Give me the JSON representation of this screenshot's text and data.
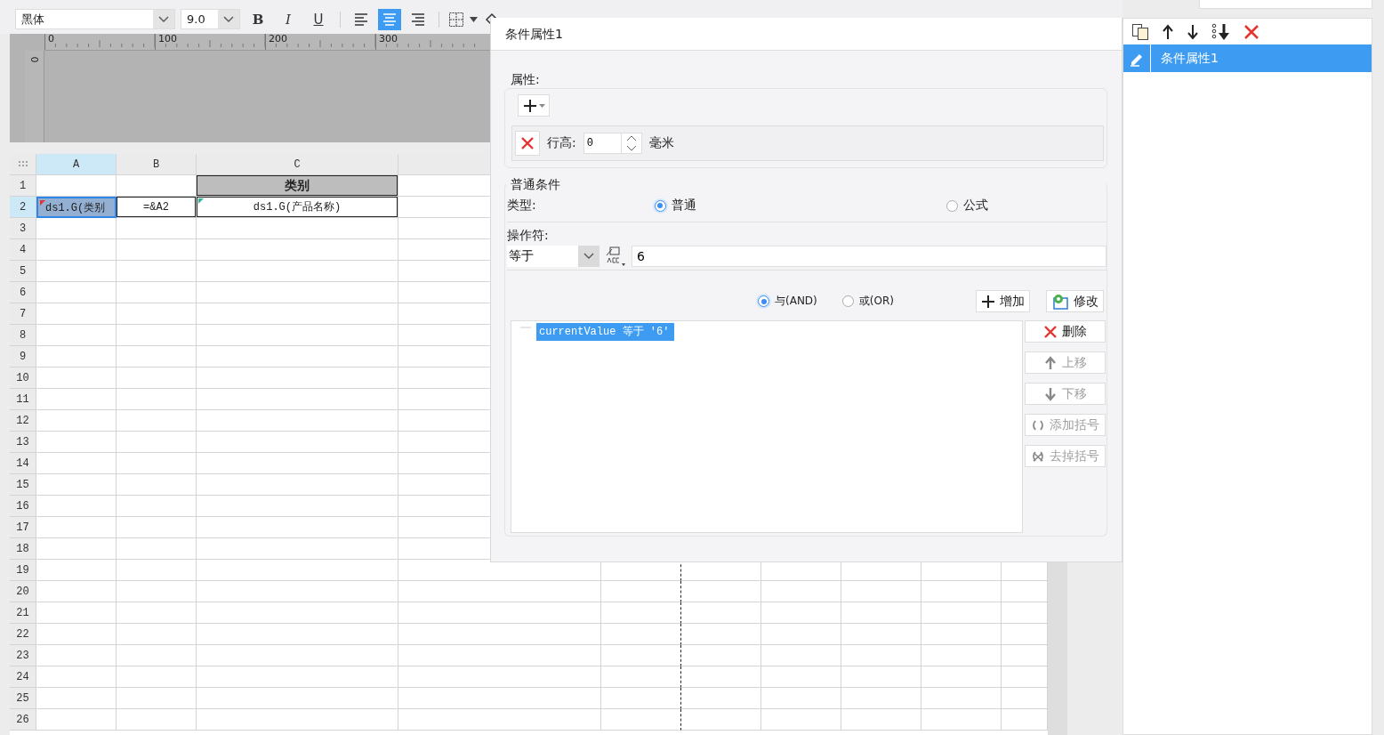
{
  "toolbar": {
    "font": "黑体",
    "size": "9.0",
    "format_buttons": [
      {
        "kind": "bold",
        "label": "B"
      },
      {
        "kind": "italic",
        "label": "I"
      },
      {
        "kind": "underline",
        "label": "U"
      }
    ],
    "align_buttons": [
      {
        "kind": "left",
        "selected": false
      },
      {
        "kind": "center",
        "selected": true
      },
      {
        "kind": "right",
        "selected": false
      }
    ]
  },
  "ruler": {
    "ticks": [
      "0",
      "100",
      "200",
      "300"
    ],
    "vertical_tick": "0"
  },
  "sheet": {
    "columns": [
      {
        "label": "A",
        "selected": true
      },
      {
        "label": "B",
        "selected": false
      },
      {
        "label": "C",
        "selected": false
      }
    ],
    "rows": [
      {
        "label": "1",
        "selected": false,
        "cells": [
          {
            "kind": "blank"
          },
          {
            "kind": "blank"
          },
          {
            "kind": "header",
            "text": "类别"
          }
        ]
      },
      {
        "label": "2",
        "selected": true,
        "cells": [
          {
            "kind": "selected",
            "text": "ds1.G(类别",
            "color": "#e8322f"
          },
          {
            "kind": "plain",
            "text": "=&A2"
          },
          {
            "kind": "plain",
            "text": "ds1.G(产品名称)",
            "color": "#2bb59a"
          }
        ]
      },
      {
        "label": "3",
        "selected": false
      },
      {
        "label": "4",
        "selected": false
      },
      {
        "label": "5",
        "selected": false
      },
      {
        "label": "6",
        "selected": false
      },
      {
        "label": "7",
        "selected": false
      },
      {
        "label": "8",
        "selected": false
      },
      {
        "label": "9",
        "selected": false
      },
      {
        "label": "10",
        "selected": false
      },
      {
        "label": "11",
        "selected": false
      },
      {
        "label": "12",
        "selected": false
      },
      {
        "label": "13",
        "selected": false
      },
      {
        "label": "14",
        "selected": false
      },
      {
        "label": "15",
        "selected": false
      },
      {
        "label": "16",
        "selected": false
      },
      {
        "label": "17",
        "selected": false
      },
      {
        "label": "18",
        "selected": false
      },
      {
        "label": "19",
        "selected": false
      },
      {
        "label": "20",
        "selected": false
      },
      {
        "label": "21",
        "selected": false
      },
      {
        "label": "22",
        "selected": false
      },
      {
        "label": "23",
        "selected": false
      },
      {
        "label": "24",
        "selected": false
      },
      {
        "label": "25",
        "selected": false
      },
      {
        "label": "26",
        "selected": false
      }
    ]
  },
  "dialog": {
    "title": "条件属性1",
    "properties_label": "属性:",
    "property": {
      "label": "行高:",
      "value": "0",
      "unit": "毫米"
    },
    "condition_group": "普通条件",
    "type_label": "类型:",
    "types": [
      {
        "label": "普通",
        "selected": true
      },
      {
        "label": "公式",
        "selected": false
      }
    ],
    "operator_label": "操作符:",
    "operator": "等于",
    "value": "6",
    "joins": [
      {
        "label": "与(AND)",
        "selected": true
      },
      {
        "label": "或(OR)",
        "selected": false
      }
    ],
    "add_button": "增加",
    "modify_button": "修改",
    "conditions": [
      {
        "text": "currentValue 等于 '6'",
        "selected": true
      }
    ],
    "side_buttons": [
      {
        "kind": "delete",
        "label": "删除",
        "disabled": false
      },
      {
        "kind": "up",
        "label": "上移",
        "disabled": true
      },
      {
        "kind": "down",
        "label": "下移",
        "disabled": true
      },
      {
        "kind": "add-brackets",
        "label": "添加括号",
        "disabled": true
      },
      {
        "kind": "remove-brackets",
        "label": "去掉括号",
        "disabled": true
      }
    ]
  },
  "panel": {
    "items": [
      {
        "label": "条件属性1",
        "selected": true
      }
    ]
  }
}
